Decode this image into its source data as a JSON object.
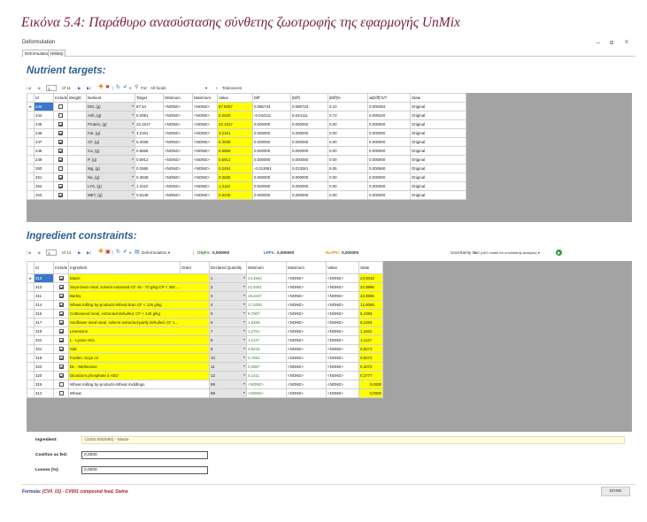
{
  "caption": "Εικόνα 5.4: Παράθυρο ανασύστασης σύνθετης ζωοτροφής της εφαρμογής UnMix",
  "window": {
    "title": "Deformulation",
    "minimize": "–",
    "maximize": "ɑ",
    "close": "X"
  },
  "tabs": [
    {
      "label": "Deformulation"
    },
    {
      "label": "History"
    }
  ],
  "nutrient": {
    "title": "Nutrient targets:",
    "toolbar": {
      "nav_first": "|◀",
      "nav_prev": "◀",
      "page_input": "1",
      "page_of": "of 11",
      "nav_next": "▶",
      "nav_last": "▶|",
      "for_label": "For:",
      "for_value": "All foods",
      "tolerances": "Tolerances"
    },
    "columns": [
      "Id",
      "Include",
      "Weight",
      "Nutrient",
      "Target",
      "Minimum",
      "Maximum",
      "Value",
      "Diff",
      "|Diff|",
      "|Diff|%",
      "w|Diff|^2/T",
      "State"
    ],
    "rows": [
      {
        "id": "243",
        "include": false,
        "weight": "",
        "nutrient": "DM, (g)",
        "target": "87.54",
        "min": "<NONE>",
        "max": "<NONE>",
        "value": "87.8257",
        "diff": "0.085733",
        "adiff": "0.085733",
        "pdiff": "0.10",
        "w": "0.000084",
        "state": "Original"
      },
      {
        "id": "244",
        "include": false,
        "weight": "",
        "nutrient": "Ash, (g)",
        "target": "6.0081",
        "min": "<NONE>",
        "max": "<NONE>",
        "value": "6.0420",
        "diff": "-0.044111",
        "adiff": "0.044111",
        "pdiff": "0.72",
        "w": "0.000320",
        "state": "Original"
      },
      {
        "id": "245",
        "include": true,
        "weight": "",
        "nutrient": "Protein, (g)",
        "target": "22.1917",
        "min": "<NONE>",
        "max": "<NONE>",
        "value": "22.1917",
        "diff": "0.000000",
        "adiff": "0.000000",
        "pdiff": "0.00",
        "w": "0.000000",
        "state": "Original"
      },
      {
        "id": "246",
        "include": true,
        "weight": "",
        "nutrient": "Fat, (g)",
        "target": "3.2161",
        "min": "<NONE>",
        "max": "<NONE>",
        "value": "3.2161",
        "diff": "0.000000",
        "adiff": "0.000000",
        "pdiff": "0.00",
        "w": "0.000000",
        "state": "Original"
      },
      {
        "id": "247",
        "include": true,
        "weight": "",
        "nutrient": "CF, (g)",
        "target": "6.3038",
        "min": "<NONE>",
        "max": "<NONE>",
        "value": "6.3038",
        "diff": "0.000000",
        "adiff": "0.000000",
        "pdiff": "0.00",
        "w": "0.000000",
        "state": "Original"
      },
      {
        "id": "248",
        "include": true,
        "weight": "",
        "nutrient": "Ca, (g)",
        "target": "0.6558",
        "min": "<NONE>",
        "max": "<NONE>",
        "value": "0.6558",
        "diff": "0.000000",
        "adiff": "0.000000",
        "pdiff": "0.00",
        "w": "0.000000",
        "state": "Original"
      },
      {
        "id": "249",
        "include": true,
        "weight": "",
        "nutrient": "P, (g)",
        "target": "0.5912",
        "min": "<NONE>",
        "max": "<NONE>",
        "value": "0.5912",
        "diff": "0.000000",
        "adiff": "0.000000",
        "pdiff": "0.00",
        "w": "0.000000",
        "state": "Original"
      },
      {
        "id": "250",
        "include": false,
        "weight": "",
        "nutrient": "Mg, (g)",
        "target": "0.2585",
        "min": "<NONE>",
        "max": "<NONE>",
        "value": "0.2454",
        "diff": "-0.013061",
        "adiff": "0.013061",
        "pdiff": "5.05",
        "w": "0.000660",
        "state": "Original"
      },
      {
        "id": "251",
        "include": true,
        "weight": "",
        "nutrient": "Na, (g)",
        "target": "0.3638",
        "min": "<NONE>",
        "max": "<NONE>",
        "value": "0.3638",
        "diff": "0.000000",
        "adiff": "0.000000",
        "pdiff": "0.00",
        "w": "0.000000",
        "state": "Original"
      },
      {
        "id": "252",
        "include": true,
        "weight": "",
        "nutrient": "LYS, (g)",
        "target": "1.3110",
        "min": "<NONE>",
        "max": "<NONE>",
        "value": "1.3110",
        "diff": "0.000000",
        "adiff": "0.000000",
        "pdiff": "0.00",
        "w": "0.000000",
        "state": "Original"
      },
      {
        "id": "253",
        "include": true,
        "weight": "",
        "nutrient": "MET, (g)",
        "target": "0.6248",
        "min": "<NONE>",
        "max": "<NONE>",
        "value": "0.6248",
        "diff": "0.000000",
        "adiff": "0.000000",
        "pdiff": "0.00",
        "w": "0.000000",
        "state": "Original"
      }
    ]
  },
  "ingredient": {
    "title": "Ingredient constraints:",
    "toolbar": {
      "nav_first": "|◀",
      "nav_prev": "◀",
      "page_input": "1",
      "page_of": "of 14",
      "nav_next": "▶",
      "nav_last": "▶|",
      "mode": "Deformulation",
      "objfn_label": "ObjFn:",
      "objfn_value": "0,000000",
      "lpfn_label": "LPFn:",
      "lpfn_value": "0,000000",
      "nlpfn_label": "NLPFn:",
      "nlpfn_value": "0,000000",
      "uncert_label": "Uncertainty %:",
      "uncert_value": "IAG (IAG model for uncertainty analysis)"
    },
    "columns": [
      "Id",
      "Include",
      "Ingredient",
      "Order",
      "Declared Quantity",
      "Minimum",
      "Maximum",
      "Value",
      "State"
    ],
    "rows": [
      {
        "id": "310",
        "include": true,
        "ingredient": "Maize",
        "order": "1",
        "decl": "24,4564",
        "min": "<NONE>",
        "max": "<NONE>",
        "value": "23,0033",
        "state": "Original"
      },
      {
        "id": "313",
        "include": true,
        "ingredient": "Soya bean meal, solvent extracted-CF 45 - 70 g/kg-CP < 450 ...",
        "order": "2",
        "decl": "21,9301",
        "min": "<NONE>",
        "max": "<NONE>",
        "value": "22,9886",
        "state": "Original"
      },
      {
        "id": "311",
        "include": true,
        "ingredient": "Barley",
        "order": "3",
        "decl": "19,3427",
        "min": "<NONE>",
        "max": "<NONE>",
        "value": "22,9886",
        "state": "Original"
      },
      {
        "id": "314",
        "include": true,
        "ingredient": "Wheat milling by-products-Wheat bran CF < 125 g/kg",
        "order": "4",
        "decl": "17,5300",
        "min": "<NONE>",
        "max": "<NONE>",
        "value": "12,0059",
        "state": "Original"
      },
      {
        "id": "316",
        "include": true,
        "ingredient": "Cottonseed meal, extracted-dehulled, CF < 140 g/kg",
        "order": "5",
        "decl": "9,7907",
        "min": "<NONE>",
        "max": "<NONE>",
        "value": "6,1083",
        "state": "Original"
      },
      {
        "id": "317",
        "include": true,
        "ingredient": "Sunflower seed meal, solvent extracted-partly dehulled, CF 1...",
        "order": "6",
        "decl": "1,9259",
        "min": "<NONE>",
        "max": "<NONE>",
        "value": "6,1083",
        "state": "Original"
      },
      {
        "id": "319",
        "include": true,
        "ingredient": "Limestone",
        "order": "7",
        "decl": "1,2701",
        "min": "<NONE>",
        "max": "<NONE>",
        "value": "1,1652",
        "state": "Original"
      },
      {
        "id": "322",
        "include": true,
        "ingredient": "L - Lysine HCL",
        "order": "8",
        "decl": "1,1127",
        "min": "<NONE>",
        "max": "<NONE>",
        "value": "1,1127",
        "state": "Original"
      },
      {
        "id": "321",
        "include": true,
        "ingredient": "Salt",
        "order": "9",
        "decl": "0,8233",
        "min": "<NONE>",
        "max": "<NONE>",
        "value": "0,8273",
        "state": "Original"
      },
      {
        "id": "318",
        "include": true,
        "ingredient": "Fodder, Soya oil",
        "order": "10",
        "decl": "0,7563",
        "min": "<NONE>",
        "max": "<NONE>",
        "value": "0,8273",
        "state": "Original"
      },
      {
        "id": "323",
        "include": true,
        "ingredient": "DL - Methionine",
        "order": "11",
        "decl": "0,2957",
        "min": "<NONE>",
        "max": "<NONE>",
        "value": "0,2073",
        "state": "Original"
      },
      {
        "id": "320",
        "include": true,
        "ingredient": "Dicalcium phosphate 2 H2O",
        "order": "12",
        "decl": "0,1411",
        "min": "<NONE>",
        "max": "<NONE>",
        "value": "0,2777",
        "state": "Original"
      },
      {
        "id": "315",
        "include": false,
        "ingredient": "Wheat milling by-products-Wheat middlings",
        "order": "99",
        "decl": "<NONE>",
        "min": "<NONE>",
        "max": "<NONE>",
        "value": "0,0000",
        "state": "Original"
      },
      {
        "id": "312",
        "include": false,
        "ingredient": "Wheat",
        "order": "99",
        "decl": "<NONE>",
        "min": "<NONE>",
        "max": "<NONE>",
        "value": "0,0000",
        "state": "Original"
      }
    ]
  },
  "details": {
    "ingredient_label": "Ingredient:",
    "ingredient_value": "(1002.000/080) - Maize",
    "cost_label": "Cost/ton as fed:",
    "cost_value": "0,0000",
    "losses_label": "Losses (%):",
    "losses_value": "0,0000"
  },
  "status": {
    "formula_label": "Formula:",
    "formula_value": "(CV0_01) - CV001 compound feed, Swine",
    "done_label": "DONE"
  },
  "colors": {
    "caption": "#7b1f3c",
    "section_title": "#2c5f93",
    "highlight": "#ffff00",
    "declared_text": "#2e8b2e",
    "grid_bg": "#a3a3a3",
    "formula_value": "#b2182b"
  }
}
